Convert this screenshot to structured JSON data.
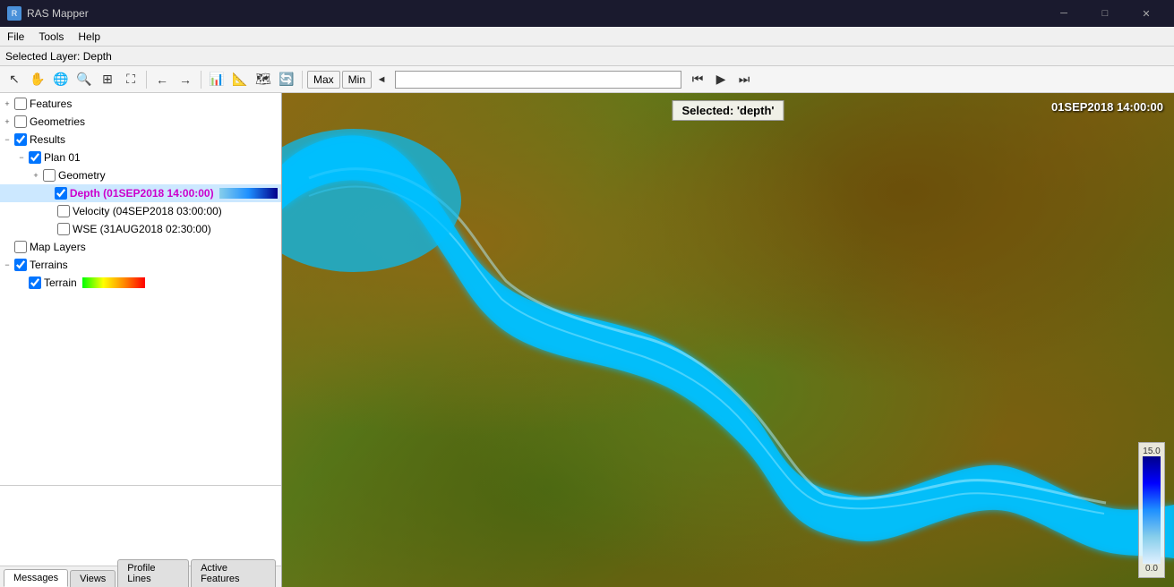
{
  "titlebar": {
    "app_icon": "R",
    "title": "RAS Mapper",
    "minimize": "─",
    "maximize": "□",
    "close": "✕"
  },
  "menubar": {
    "items": [
      "File",
      "Tools",
      "Help"
    ]
  },
  "selected_layer_bar": {
    "label": "Selected Layer:",
    "layer": "Depth"
  },
  "toolbar": {
    "max_label": "Max",
    "min_label": "Min",
    "arrow_left": "◄"
  },
  "layer_tree": {
    "items": [
      {
        "id": "features",
        "indent": 0,
        "expand": "+",
        "checked": false,
        "label": "Features",
        "highlighted": false
      },
      {
        "id": "geometries",
        "indent": 0,
        "expand": "+",
        "checked": false,
        "label": "Geometries",
        "highlighted": false
      },
      {
        "id": "results",
        "indent": 0,
        "expand": "−",
        "checked": true,
        "label": "Results",
        "highlighted": false
      },
      {
        "id": "plan01",
        "indent": 1,
        "expand": "−",
        "checked": true,
        "label": "Plan 01",
        "highlighted": false
      },
      {
        "id": "geometry",
        "indent": 2,
        "expand": "+",
        "checked": false,
        "label": "Geometry",
        "highlighted": false
      },
      {
        "id": "depth",
        "indent": 3,
        "expand": "",
        "checked": true,
        "label": "Depth (01SEP2018 14:00:00)",
        "highlighted": true,
        "has_color_bar": true,
        "color_bar_type": "depth"
      },
      {
        "id": "velocity",
        "indent": 3,
        "expand": "",
        "checked": false,
        "label": "Velocity (04SEP2018 03:00:00)",
        "highlighted": false
      },
      {
        "id": "wse",
        "indent": 3,
        "expand": "",
        "checked": false,
        "label": "WSE (31AUG2018 02:30:00)",
        "highlighted": false
      },
      {
        "id": "map_layers",
        "indent": 0,
        "expand": "",
        "checked": false,
        "label": "Map Layers",
        "highlighted": false
      },
      {
        "id": "terrains",
        "indent": 0,
        "expand": "−",
        "checked": true,
        "label": "Terrains",
        "highlighted": false
      },
      {
        "id": "terrain",
        "indent": 1,
        "expand": "",
        "checked": true,
        "label": "Terrain",
        "highlighted": false,
        "has_color_bar": true,
        "color_bar_type": "terrain"
      }
    ]
  },
  "map": {
    "selected_label": "Selected: 'depth'",
    "datetime": "01SEP2018 14:00:00"
  },
  "scale": {
    "max_value": "15.0",
    "min_value": "0.0"
  },
  "bottom_tabs": {
    "tabs": [
      "Messages",
      "Views",
      "Profile Lines",
      "Active Features"
    ],
    "active": "Messages"
  }
}
